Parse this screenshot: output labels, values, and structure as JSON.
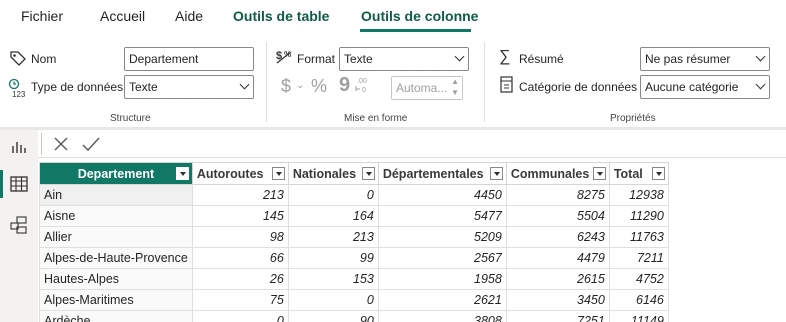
{
  "tabs": [
    {
      "label": "Fichier"
    },
    {
      "label": "Accueil"
    },
    {
      "label": "Aide"
    },
    {
      "label": "Outils de table"
    },
    {
      "label": "Outils de colonne"
    }
  ],
  "structure": {
    "group_label": "Structure",
    "name_label": "Nom",
    "name_value": "Departement",
    "datatype_label": "Type de données",
    "datatype_value": "Texte"
  },
  "format": {
    "group_label": "Mise en forme",
    "format_label": "Format",
    "format_value": "Texte",
    "currency_symbol": "$",
    "percent_symbol": "%",
    "comma_symbol": "9",
    "decimals_value": "Automa..."
  },
  "properties": {
    "group_label": "Propriétés",
    "summary_label": "Résumé",
    "summary_value": "Ne pas résumer",
    "category_label": "Catégorie de données",
    "category_value": "Aucune catégorie"
  },
  "icons": {
    "name": "tag-icon",
    "datatype": "datatype-123-icon",
    "format": "format-icon",
    "summary": "sigma-icon",
    "category": "category-icon",
    "report": "report-view-icon",
    "table": "table-view-icon",
    "model": "model-view-icon",
    "cancel": "close-icon",
    "commit": "check-icon"
  },
  "table": {
    "columns": [
      "Departement",
      "Autoroutes",
      "Nationales",
      "Départementales",
      "Communales",
      "Total"
    ],
    "rows": [
      [
        "Ain",
        "213",
        "0",
        "4450",
        "8275",
        "12938"
      ],
      [
        "Aisne",
        "145",
        "164",
        "5477",
        "5504",
        "11290"
      ],
      [
        "Allier",
        "98",
        "213",
        "5209",
        "6243",
        "11763"
      ],
      [
        "Alpes-de-Haute-Provence",
        "66",
        "99",
        "2567",
        "4479",
        "7211"
      ],
      [
        "Hautes-Alpes",
        "26",
        "153",
        "1958",
        "2615",
        "4752"
      ],
      [
        "Alpes-Maritimes",
        "75",
        "0",
        "2621",
        "3450",
        "6146"
      ],
      [
        "Ardèche",
        "0",
        "90",
        "3808",
        "7251",
        "11149"
      ]
    ]
  },
  "colors": {
    "accent": "#117865",
    "header_selected": "#117865"
  }
}
